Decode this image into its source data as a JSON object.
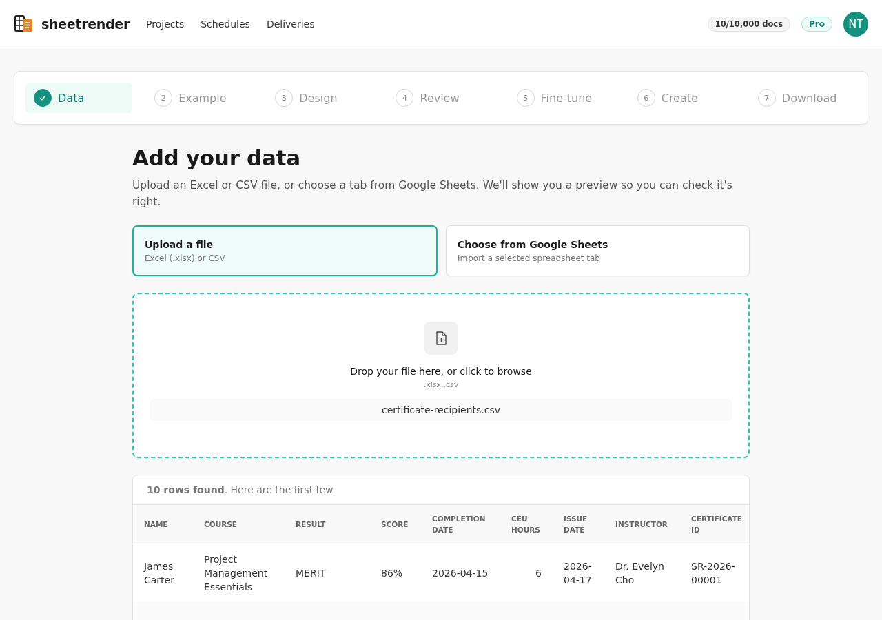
{
  "brand": {
    "name": "sheetrender"
  },
  "nav": [
    "Projects",
    "Schedules",
    "Deliveries"
  ],
  "usage": "10/10,000 docs",
  "plan": "Pro",
  "avatar": "NT",
  "steps": [
    {
      "label": "Data",
      "done": true,
      "selected": true
    },
    {
      "number": "2",
      "label": "Example",
      "done": false,
      "selected": false
    },
    {
      "number": "3",
      "label": "Design",
      "done": false,
      "selected": false
    },
    {
      "number": "4",
      "label": "Review",
      "done": false,
      "selected": false
    },
    {
      "number": "5",
      "label": "Fine-tune",
      "done": false,
      "selected": false
    },
    {
      "number": "6",
      "label": "Create",
      "done": false,
      "selected": false
    },
    {
      "number": "7",
      "label": "Download",
      "done": false,
      "selected": false
    }
  ],
  "heading": "Add your data",
  "intro": "Upload an Excel or CSV file, or choose a tab from Google Sheets. We'll show you a preview so you can check it's right.",
  "sources": [
    {
      "title": "Upload a file",
      "subtitle": "Excel (.xlsx) or CSV",
      "selected": true
    },
    {
      "title": "Choose from Google Sheets",
      "subtitle": "Import a selected spreadsheet tab",
      "selected": false
    }
  ],
  "dropzone": {
    "prompt": "Drop your file here, or click to browse",
    "accepts": ".xlsx,.csv",
    "file": "certificate-recipients.csv"
  },
  "preview": {
    "summary": "**10 rows found**. Here are the first few",
    "columns": [
      "NAME",
      "COURSE",
      "RESULT",
      "SCORE",
      "COMPLETION DATE",
      "CEU HOURS",
      "ISSUE DATE",
      "INSTRUCTOR",
      "CERTIFICATE ID"
    ],
    "rows": [
      [
        "James Carter",
        "Project Management Essentials",
        "MERIT",
        "86%",
        "2026-04-15",
        "6",
        "2026-04-17",
        "Dr. Evelyn Cho",
        "SR-2026-00001"
      ]
    ]
  }
}
